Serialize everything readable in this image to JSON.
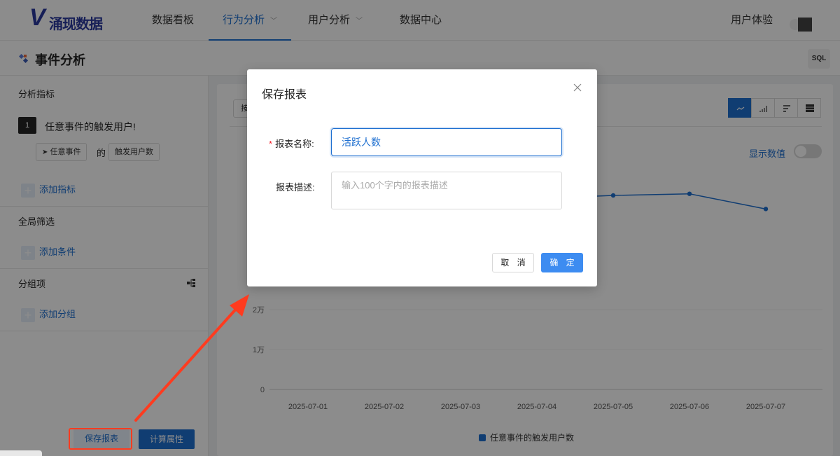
{
  "nav": {
    "logo_letter": "V",
    "logo_text": "涌现数据",
    "items": [
      {
        "label": "数据看板"
      },
      {
        "label": "行为分析"
      },
      {
        "label": "用户分析"
      },
      {
        "label": "数据中心"
      }
    ],
    "right_label": "用户体验"
  },
  "page": {
    "title": "事件分析",
    "sql_label": "SQL"
  },
  "sidebar": {
    "metrics_title": "分析指标",
    "metric_index": "1",
    "metric_name": "任意事件的触发用户!",
    "event_chip": "任意事件",
    "of_label": "的",
    "measure_chip": "触发用户数",
    "add_metric": "添加指标",
    "filter_title": "全局筛选",
    "add_condition": "添加条件",
    "group_title": "分组项",
    "add_group": "添加分组",
    "save_report": "保存报表",
    "calc_attr": "计算属性"
  },
  "main": {
    "time_btn_label": "按",
    "show_values_label": "显示数值",
    "legend_label": "任意事件的触发用户数"
  },
  "chart_data": {
    "type": "line",
    "categories": [
      "2025-07-01",
      "2025-07-02",
      "2025-07-03",
      "2025-07-04",
      "2025-07-05",
      "2025-07-06",
      "2025-07-07"
    ],
    "y_ticks": [
      "0",
      "1万",
      "2万"
    ],
    "visible_points": [
      {
        "x": "2025-07-05",
        "y": 48600
      },
      {
        "x": "2025-07-06",
        "y": 49000
      },
      {
        "x": "2025-07-07",
        "y": 45200
      }
    ],
    "series": [
      {
        "name": "任意事件的触发用户数"
      }
    ]
  },
  "modal": {
    "title": "保存报表",
    "name_label": "报表名称:",
    "name_value": "活跃人数",
    "desc_label": "报表描述:",
    "desc_placeholder": "输入100个字内的报表描述",
    "cancel_label": "取 消",
    "ok_label": "确 定"
  },
  "colors": {
    "primary": "#1e6fd0",
    "annotation": "#ff3b1f"
  }
}
